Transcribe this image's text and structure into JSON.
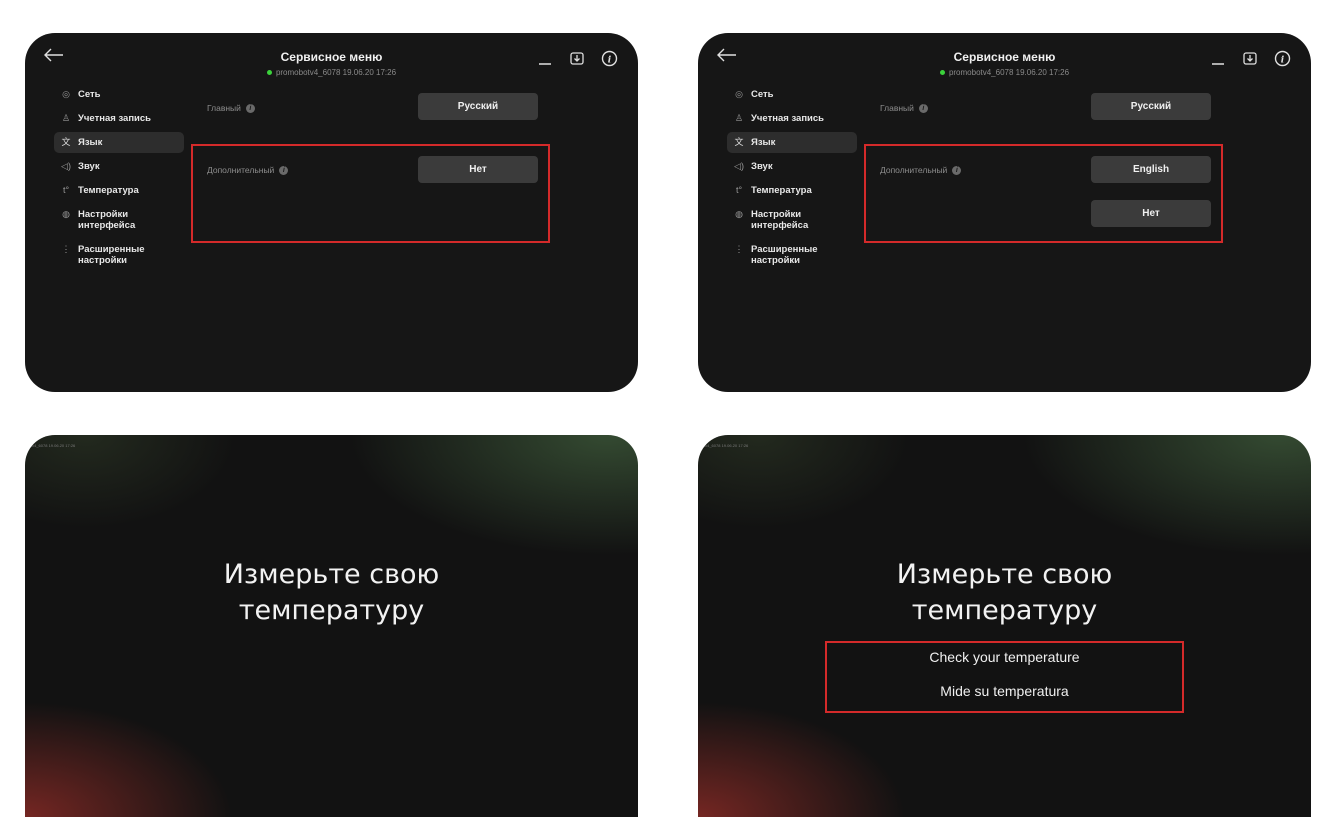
{
  "menu": {
    "title": "Сервисное меню",
    "subtitle": "promobotv4_6078 19.06.20  17:26",
    "sidebar": [
      {
        "label": "Сеть",
        "icon": "globe-icon"
      },
      {
        "label": "Учетная запись",
        "icon": "user-icon"
      },
      {
        "label": "Язык",
        "icon": "language-icon"
      },
      {
        "label": "Звук",
        "icon": "sound-icon"
      },
      {
        "label": "Температура",
        "icon": "thermometer-icon"
      },
      {
        "label": "Настройки интерфейса",
        "icon": "palette-icon"
      },
      {
        "label": "Расширенные настройки",
        "icon": "vertical-dots-icon"
      }
    ],
    "primary_label": "Главный",
    "primary_value": "Русский",
    "secondary_label": "Дополнительный",
    "panel1_secondary_value": "Нет",
    "panel2_secondary_values": [
      "English",
      "Нет"
    ]
  },
  "screen": {
    "id_text": "tv4_6078 19.06.20  17:26",
    "heading_line1": "Измерьте свою",
    "heading_line2": "температуру",
    "extra_lines": [
      "Check your temperature",
      "Mide su temperatura"
    ]
  },
  "colors": {
    "highlight": "#d42a2a",
    "status_dot": "#3bd23b",
    "panel_bg": "#161616"
  }
}
